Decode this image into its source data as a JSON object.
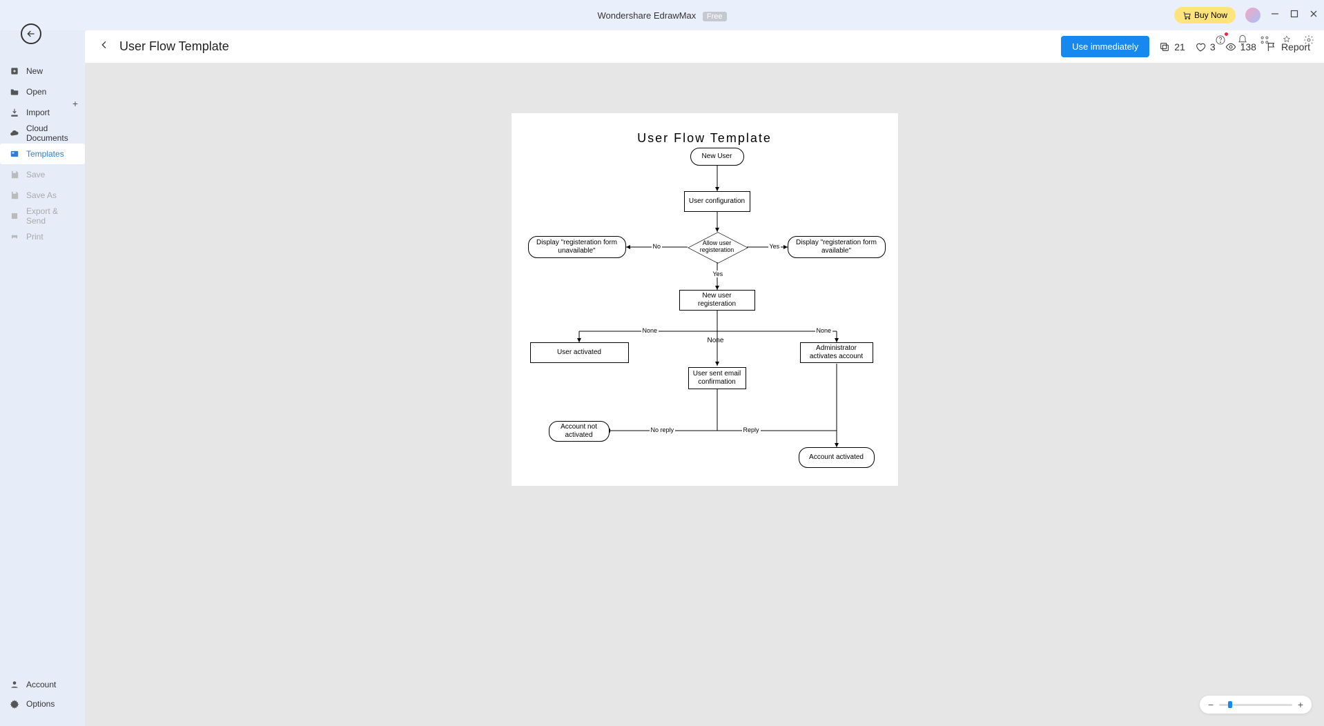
{
  "title": "Wondershare EdrawMax",
  "edition": "Free",
  "buy": "Buy Now",
  "sidebar": {
    "items": [
      {
        "label": "New"
      },
      {
        "label": "Open"
      },
      {
        "label": "Import"
      },
      {
        "label": "Cloud Documents"
      },
      {
        "label": "Templates"
      },
      {
        "label": "Save"
      },
      {
        "label": "Save As"
      },
      {
        "label": "Export & Send"
      },
      {
        "label": "Print"
      }
    ],
    "account": "Account",
    "options": "Options"
  },
  "header": {
    "page_title": "User Flow Template",
    "use_btn": "Use immediately",
    "copies": "21",
    "likes": "3",
    "views": "138",
    "report": "Report"
  },
  "diagram": {
    "title": "User Flow Template",
    "nodes": {
      "new_user": "New User",
      "user_config": "User configuration",
      "decision": "Allow user registeration",
      "display_unavail": "Display \"registeration form unavailable\"",
      "display_avail": "Display \"registeration form available\"",
      "new_user_reg": "New user registeration",
      "user_activated": "User activated",
      "none_mid": "None",
      "admin_activates": "Administrator activates account",
      "user_sent_email": "User sent email confirmation",
      "acct_not_activated": "Account not activated",
      "acct_activated": "Account activated"
    },
    "labels": {
      "no": "No",
      "yes_right": "Yes",
      "yes_down": "Yes",
      "none_l": "None",
      "none_r": "None",
      "no_reply": "No reply",
      "reply": "Reply"
    }
  }
}
